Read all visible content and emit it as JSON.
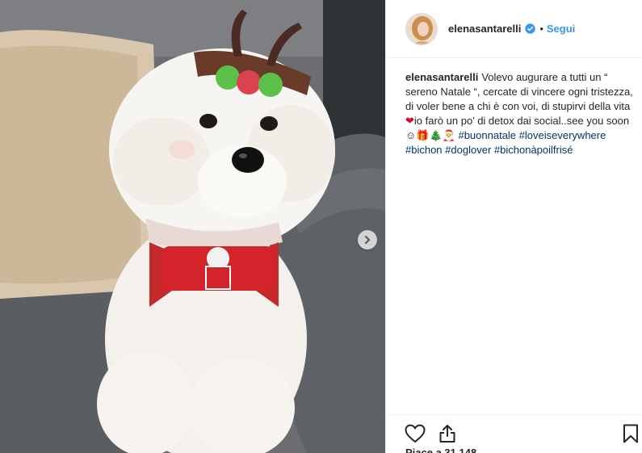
{
  "post": {
    "username": "elenasantarelli",
    "verified": true,
    "separator": "•",
    "follow_label": "Segui"
  },
  "caption": {
    "username": "elenasantarelli",
    "text_part1": "Volevo augurare a tutti un “ sereno Natale “, cercate di vincere ogni tristezza, di voler bene a chi è con voi, di stupirvi della vita ",
    "heart": "❤",
    "text_part2": "io farò un po’ di detox dai social..see you soon ☺🎁🎄🎅",
    "hashtags": [
      "#buonnatale",
      "#loveiseverywhere",
      "#bichon",
      "#doglover",
      "#bichonàpoilfrisé"
    ]
  },
  "actions": {
    "like_icon": "heart-outline-icon",
    "share_icon": "share-icon",
    "save_icon": "bookmark-icon"
  },
  "likes_text": "Piace a 31.148",
  "colors": {
    "follow": "#3897f0",
    "hashtag": "#003569",
    "verified": "#3897f0",
    "text": "#262626",
    "border": "#efefef"
  }
}
